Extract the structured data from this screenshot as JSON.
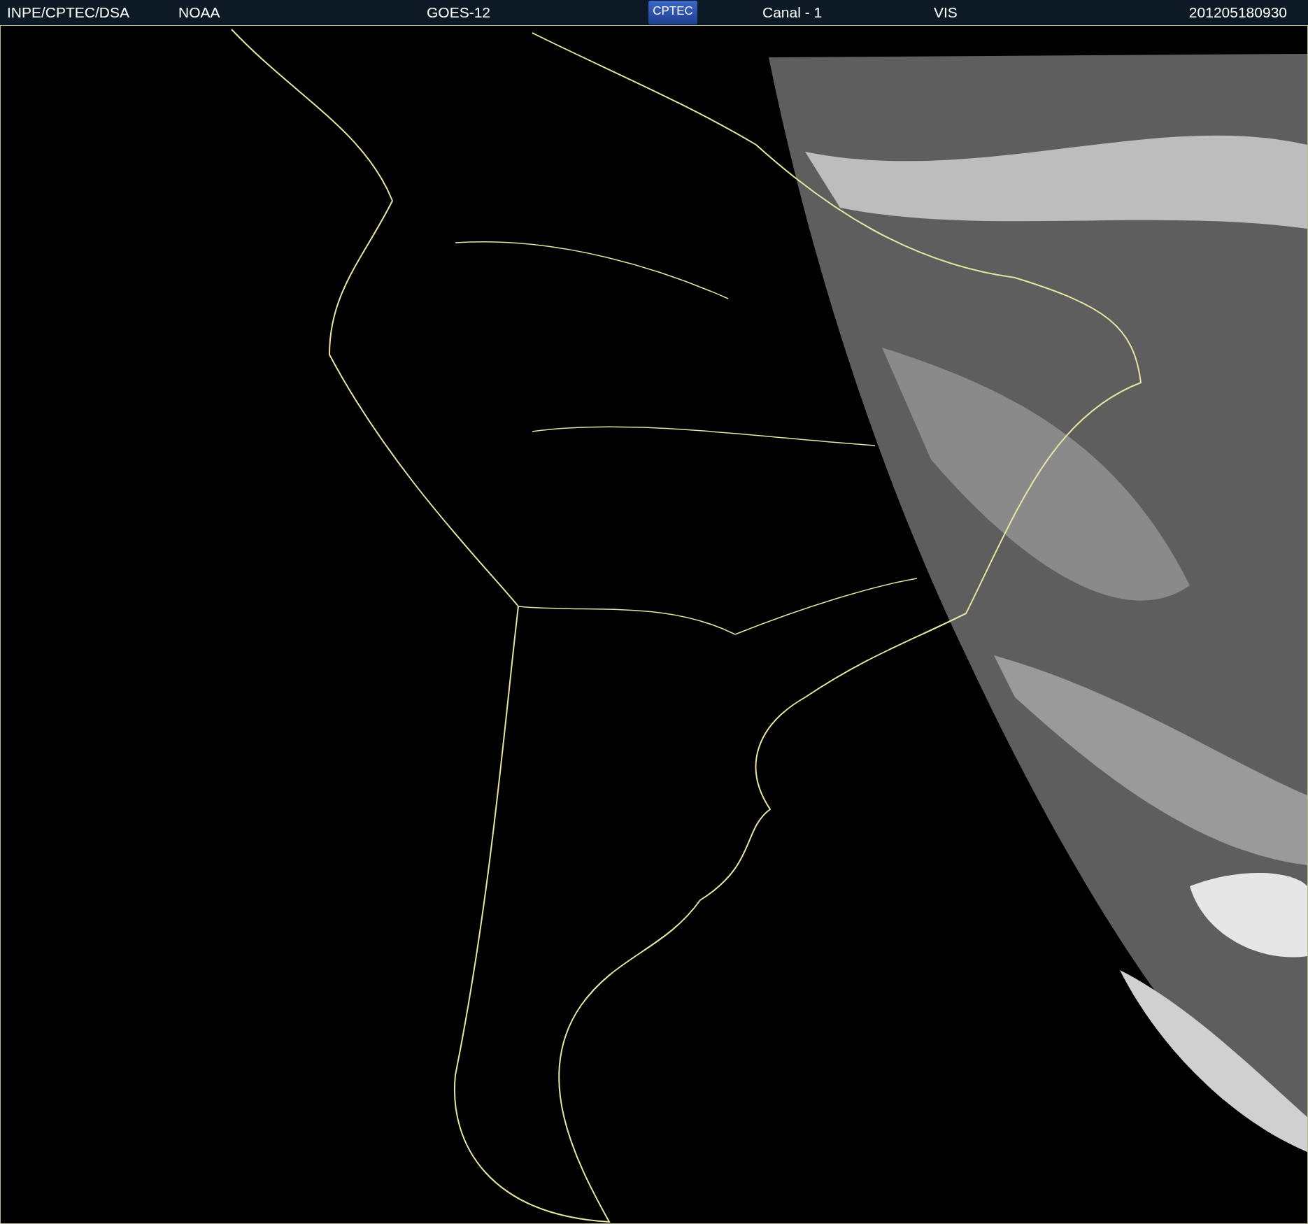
{
  "header": {
    "items": [
      {
        "kind": "text",
        "text": "INPE/CPTEC/DSA"
      },
      {
        "kind": "text",
        "text": "NOAA"
      },
      {
        "kind": "text",
        "text": "GOES-12"
      },
      {
        "kind": "logo",
        "text": "CPTEC"
      },
      {
        "kind": "text",
        "text": "Canal - 1"
      },
      {
        "kind": "text",
        "text": "VIS"
      },
      {
        "kind": "text",
        "text": "201205180930"
      }
    ]
  }
}
